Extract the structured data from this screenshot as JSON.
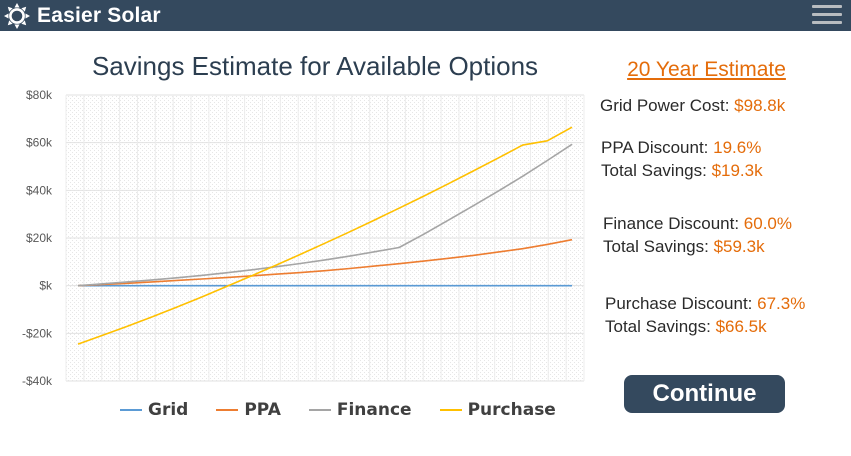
{
  "app": {
    "name": "Easier Solar"
  },
  "header": {
    "logo_icon": "sun-icon",
    "menu_icon": "hamburger-menu-icon",
    "background": "#34495e"
  },
  "estimate": {
    "title": "20 Year Estimate",
    "grid_cost_label": "Grid Power Cost: ",
    "grid_cost_value": "$98.8k",
    "ppa": {
      "discount_label": "PPA Discount: ",
      "discount_value": "19.6%",
      "savings_label": "Total Savings: ",
      "savings_value": "$19.3k"
    },
    "finance": {
      "discount_label": "Finance Discount: ",
      "discount_value": "60.0%",
      "savings_label": "Total Savings: ",
      "savings_value": "$59.3k"
    },
    "purchase": {
      "discount_label": "Purchase Discount: ",
      "discount_value": "67.3%",
      "savings_label": "Total Savings: ",
      "savings_value": "$66.5k"
    }
  },
  "continue_label": "Continue",
  "colors": {
    "accent": "#e46c0a",
    "header": "#34495e",
    "button": "#34495e"
  },
  "chart_data": {
    "type": "line",
    "title": "Savings Estimate for Available Options",
    "xlabel": "",
    "ylabel": "",
    "ylim": [
      -40,
      80
    ],
    "yticks": [
      80,
      60,
      40,
      20,
      0,
      -20,
      -40
    ],
    "ytick_labels": [
      "$80k",
      "$60k",
      "$40k",
      "$20k",
      "$k",
      "-$20k",
      "-$40k"
    ],
    "x": [
      0,
      1,
      2,
      3,
      4,
      5,
      6,
      7,
      8,
      9,
      10,
      11,
      12,
      13,
      14,
      15,
      16,
      17,
      18,
      19,
      20
    ],
    "grid": true,
    "legend_position": "bottom",
    "series": [
      {
        "name": "Grid",
        "color": "#5b9bd5",
        "values": [
          0,
          0,
          0,
          0,
          0,
          0,
          0,
          0,
          0,
          0,
          0,
          0,
          0,
          0,
          0,
          0,
          0,
          0,
          0,
          0,
          0
        ]
      },
      {
        "name": "PPA",
        "color": "#ed7d31",
        "values": [
          0,
          0.5,
          1.0,
          1.6,
          2.2,
          2.8,
          3.4,
          4.1,
          4.8,
          5.5,
          6.3,
          7.2,
          8.2,
          9.2,
          10.3,
          11.5,
          12.7,
          14.1,
          15.5,
          17.3,
          19.3
        ]
      },
      {
        "name": "Finance",
        "color": "#a5a5a5",
        "values": [
          0,
          0.8,
          1.6,
          2.4,
          3.3,
          4.3,
          5.4,
          6.6,
          7.9,
          9.3,
          10.8,
          12.4,
          14.2,
          16.0,
          21.6,
          27.5,
          33.5,
          39.6,
          45.9,
          52.5,
          59.3
        ]
      },
      {
        "name": "Purchase",
        "color": "#ffc000",
        "values": [
          -24.5,
          -20.8,
          -17.0,
          -13.1,
          -9.0,
          -4.8,
          -0.4,
          4.0,
          8.5,
          13.1,
          17.8,
          22.6,
          27.5,
          32.5,
          37.6,
          42.8,
          48.1,
          53.5,
          59.0,
          60.8,
          66.5
        ]
      }
    ]
  }
}
